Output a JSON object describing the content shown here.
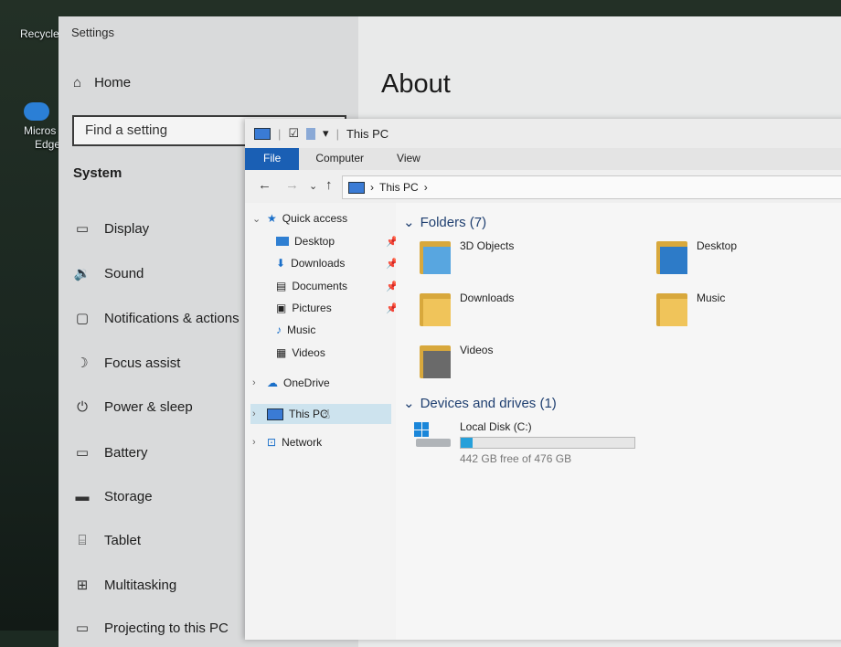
{
  "desktop": {
    "recycle_label": "Recycle",
    "edge_label_1": "Micros",
    "edge_label_2": "Edge"
  },
  "settings": {
    "window_title": "Settings",
    "home_label": "Home",
    "search_placeholder": "Find a setting",
    "section_title": "System",
    "page_title": "About",
    "nav_items": [
      {
        "label": "Display",
        "icon": "display-icon"
      },
      {
        "label": "Sound",
        "icon": "sound-icon"
      },
      {
        "label": "Notifications & actions",
        "icon": "notifications-icon"
      },
      {
        "label": "Focus assist",
        "icon": "focus-assist-icon"
      },
      {
        "label": "Power & sleep",
        "icon": "power-icon"
      },
      {
        "label": "Battery",
        "icon": "battery-icon"
      },
      {
        "label": "Storage",
        "icon": "storage-icon"
      },
      {
        "label": "Tablet",
        "icon": "tablet-icon"
      },
      {
        "label": "Multitasking",
        "icon": "multitasking-icon"
      },
      {
        "label": "Projecting to this PC",
        "icon": "projecting-icon"
      }
    ]
  },
  "explorer": {
    "window_title": "This PC",
    "ribbon_tabs": [
      "File",
      "Computer",
      "View"
    ],
    "address_path": "This PC",
    "nav_pane": {
      "quick_access": "Quick access",
      "quick_items": [
        {
          "label": "Desktop",
          "pinned": true
        },
        {
          "label": "Downloads",
          "pinned": true
        },
        {
          "label": "Documents",
          "pinned": true
        },
        {
          "label": "Pictures",
          "pinned": true
        },
        {
          "label": "Music",
          "pinned": false
        },
        {
          "label": "Videos",
          "pinned": false
        }
      ],
      "onedrive": "OneDrive",
      "this_pc": "This PC",
      "network": "Network"
    },
    "folders_header": "Folders (7)",
    "folders": [
      "3D Objects",
      "Desktop",
      "Downloads",
      "Music",
      "Videos"
    ],
    "devices_header": "Devices and drives (1)",
    "drive": {
      "name": "Local Disk (C:)",
      "free_text": "442 GB free of 476 GB",
      "used_fraction": 0.07
    }
  },
  "colors": {
    "accent": "#1a5fb4",
    "drive_fill": "#26a0da",
    "group_header": "#1f3f70"
  }
}
